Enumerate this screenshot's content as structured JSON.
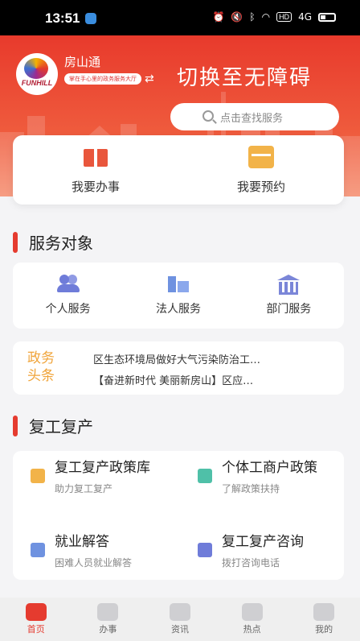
{
  "status": {
    "time": "13:51",
    "hd": "HD",
    "signal": "4G"
  },
  "header": {
    "logo_text": "FUNHILL",
    "app_name": "房山通",
    "slogan": "掌在手心里的政务服务大厅",
    "accessibility_label": "切换至无障碍",
    "search_placeholder": "点击查找服务"
  },
  "quick_actions": [
    {
      "label": "我要办事",
      "icon": "book-icon"
    },
    {
      "label": "我要预约",
      "icon": "calendar-icon"
    }
  ],
  "service_section": {
    "title": "服务对象",
    "items": [
      {
        "label": "个人服务",
        "icon": "person-icon"
      },
      {
        "label": "法人服务",
        "icon": "building-icon"
      },
      {
        "label": "部门服务",
        "icon": "government-icon"
      }
    ]
  },
  "news": {
    "label_line1": "政务",
    "label_line2": "头条",
    "items": [
      "区生态环境局做好大气污染防治工…",
      "【奋进新时代 美丽新房山】区应…"
    ]
  },
  "resume_section": {
    "title": "复工复产",
    "items": [
      {
        "title": "复工复产政策库",
        "subtitle": "助力复工复产",
        "color": "#f2b349"
      },
      {
        "title": "个体工商户政策",
        "subtitle": "了解政策扶持",
        "color": "#4fc0a8"
      },
      {
        "title": "就业解答",
        "subtitle": "困难人员就业解答",
        "color": "#6f92e0"
      },
      {
        "title": "复工复产咨询",
        "subtitle": "拨打咨询电话",
        "color": "#6f7cd9"
      }
    ]
  },
  "tabbar": [
    {
      "label": "首页",
      "icon": "home-icon",
      "active": true
    },
    {
      "label": "办事",
      "icon": "pen-icon",
      "active": false
    },
    {
      "label": "资讯",
      "icon": "news-icon",
      "active": false
    },
    {
      "label": "热点",
      "icon": "flame-icon",
      "active": false
    },
    {
      "label": "我的",
      "icon": "user-icon",
      "active": false
    }
  ],
  "colors": {
    "brand": "#e53b2f",
    "accent": "#f0a43a"
  }
}
